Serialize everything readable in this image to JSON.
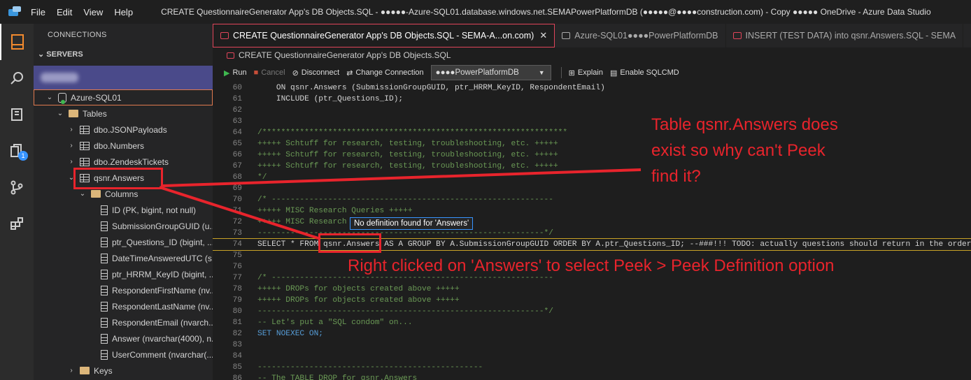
{
  "titlebar": {
    "menu": [
      "File",
      "Edit",
      "View",
      "Help"
    ],
    "title": "CREATE QuestionnaireGenerator App's DB Objects.SQL - ●●●●●-Azure-SQL01.database.windows.net.SEMAPowerPlatformDB (●●●●●@●●●●construction.com) - Copy ●●●●● OneDrive - Azure Data Studio"
  },
  "sidebar": {
    "header": "CONNECTIONS",
    "section": "SERVERS",
    "server": "Azure-SQL01",
    "tables_folder": "Tables",
    "tables": [
      "dbo.JSONPayloads",
      "dbo.Numbers",
      "dbo.ZendeskTickets",
      "qsnr.Answers"
    ],
    "columns_folder": "Columns",
    "columns": [
      "ID (PK, bigint, not null)",
      "SubmissionGroupGUID (u...",
      "ptr_Questions_ID (bigint, ...",
      "DateTimeAnsweredUTC (s...",
      "ptr_HRRM_KeyID (bigint, ...",
      "RespondentFirstName (nv...",
      "RespondentLastName (nv...",
      "RespondentEmail (nvarch...",
      "Answer (nvarchar(4000), n...",
      "UserComment (nvarchar(..."
    ],
    "keys_folder": "Keys"
  },
  "tabs": [
    {
      "label": "CREATE QuestionnaireGenerator App's DB Objects.SQL - SEMA-A...on.com)",
      "close": "✕"
    },
    {
      "label": "Azure-SQL01●●●●PowerPlatformDB"
    },
    {
      "label": "INSERT (TEST DATA) into qsnr.Answers.SQL - SEMA"
    }
  ],
  "breadcrumb": "CREATE QuestionnaireGenerator App's DB Objects.SQL",
  "toolbar": {
    "run": "Run",
    "cancel": "Cancel",
    "disconnect": "Disconnect",
    "change_connection": "Change Connection",
    "database": "●●●●PowerPlatformDB",
    "explain": "Explain",
    "enable_sqlcmd": "Enable SQLCMD"
  },
  "code_lines": [
    {
      "n": "60",
      "t": "    ON qsnr.Answers (SubmissionGroupGUID, ptr_HRRM_KeyID, RespondentEmail)",
      "c": "plain"
    },
    {
      "n": "61",
      "t": "    INCLUDE (ptr_Questions_ID);",
      "c": "plain"
    },
    {
      "n": "62",
      "t": "",
      "c": "plain"
    },
    {
      "n": "63",
      "t": "",
      "c": "plain"
    },
    {
      "n": "64",
      "t": "/*****************************************************************",
      "c": "cmt"
    },
    {
      "n": "65",
      "t": "+++++ Schtuff for research, testing, troubleshooting, etc. +++++",
      "c": "cmt"
    },
    {
      "n": "66",
      "t": "+++++ Schtuff for research, testing, troubleshooting, etc. +++++",
      "c": "cmt"
    },
    {
      "n": "67",
      "t": "+++++ Schtuff for research, testing, troubleshooting, etc. +++++",
      "c": "cmt"
    },
    {
      "n": "68",
      "t": "*/",
      "c": "cmt"
    },
    {
      "n": "69",
      "t": "",
      "c": "plain"
    },
    {
      "n": "70",
      "t": "/* ------------------------------------------------------------",
      "c": "cmt"
    },
    {
      "n": "71",
      "t": "+++++ MISC Research Queries +++++",
      "c": "cmt"
    },
    {
      "n": "72",
      "t": "+++++ MISC Research",
      "c": "cmt"
    },
    {
      "n": "73",
      "t": "-------------------------------------------------------------*/",
      "c": "cmt"
    },
    {
      "n": "74",
      "t": "SELECT * FROM qsnr.Answers AS A GROUP BY A.SubmissionGroupGUID ORDER BY A.ptr_Questions_ID; --###!!! TODO: actually questions should return in the order of",
      "c": "hl"
    },
    {
      "n": "75",
      "t": "",
      "c": "plain"
    },
    {
      "n": "76",
      "t": "",
      "c": "plain"
    },
    {
      "n": "77",
      "t": "/* ------------------------------------------------------------",
      "c": "cmt"
    },
    {
      "n": "78",
      "t": "+++++ DROPs for objects created above +++++",
      "c": "cmt"
    },
    {
      "n": "79",
      "t": "+++++ DROPs for objects created above +++++",
      "c": "cmt"
    },
    {
      "n": "80",
      "t": "-------------------------------------------------------------*/",
      "c": "cmt"
    },
    {
      "n": "81",
      "t": "-- Let's put a \"SQL condom\" on...",
      "c": "cmt"
    },
    {
      "n": "82",
      "t": "SET NOEXEC ON;",
      "c": "kw"
    },
    {
      "n": "83",
      "t": "",
      "c": "plain"
    },
    {
      "n": "84",
      "t": "",
      "c": "plain"
    },
    {
      "n": "85",
      "t": "------------------------------------------------",
      "c": "cmt"
    },
    {
      "n": "86",
      "t": "-- The TABLE DROP for qsnr.Answers",
      "c": "cmt"
    }
  ],
  "tooltip": "No definition found for 'Answers'",
  "annotations": {
    "question": "Table qsnr.Answers does exist so why can't Peek find it?",
    "question_lines": [
      "Table qsnr.Answers does",
      "exist so why can't Peek",
      "find it?"
    ],
    "action": "Right clicked on 'Answers' to select Peek > Peek Definition option"
  },
  "colors": {
    "annotation": "#e8242c",
    "accent": "#3794ff",
    "server_row": "#4a4a8a"
  }
}
